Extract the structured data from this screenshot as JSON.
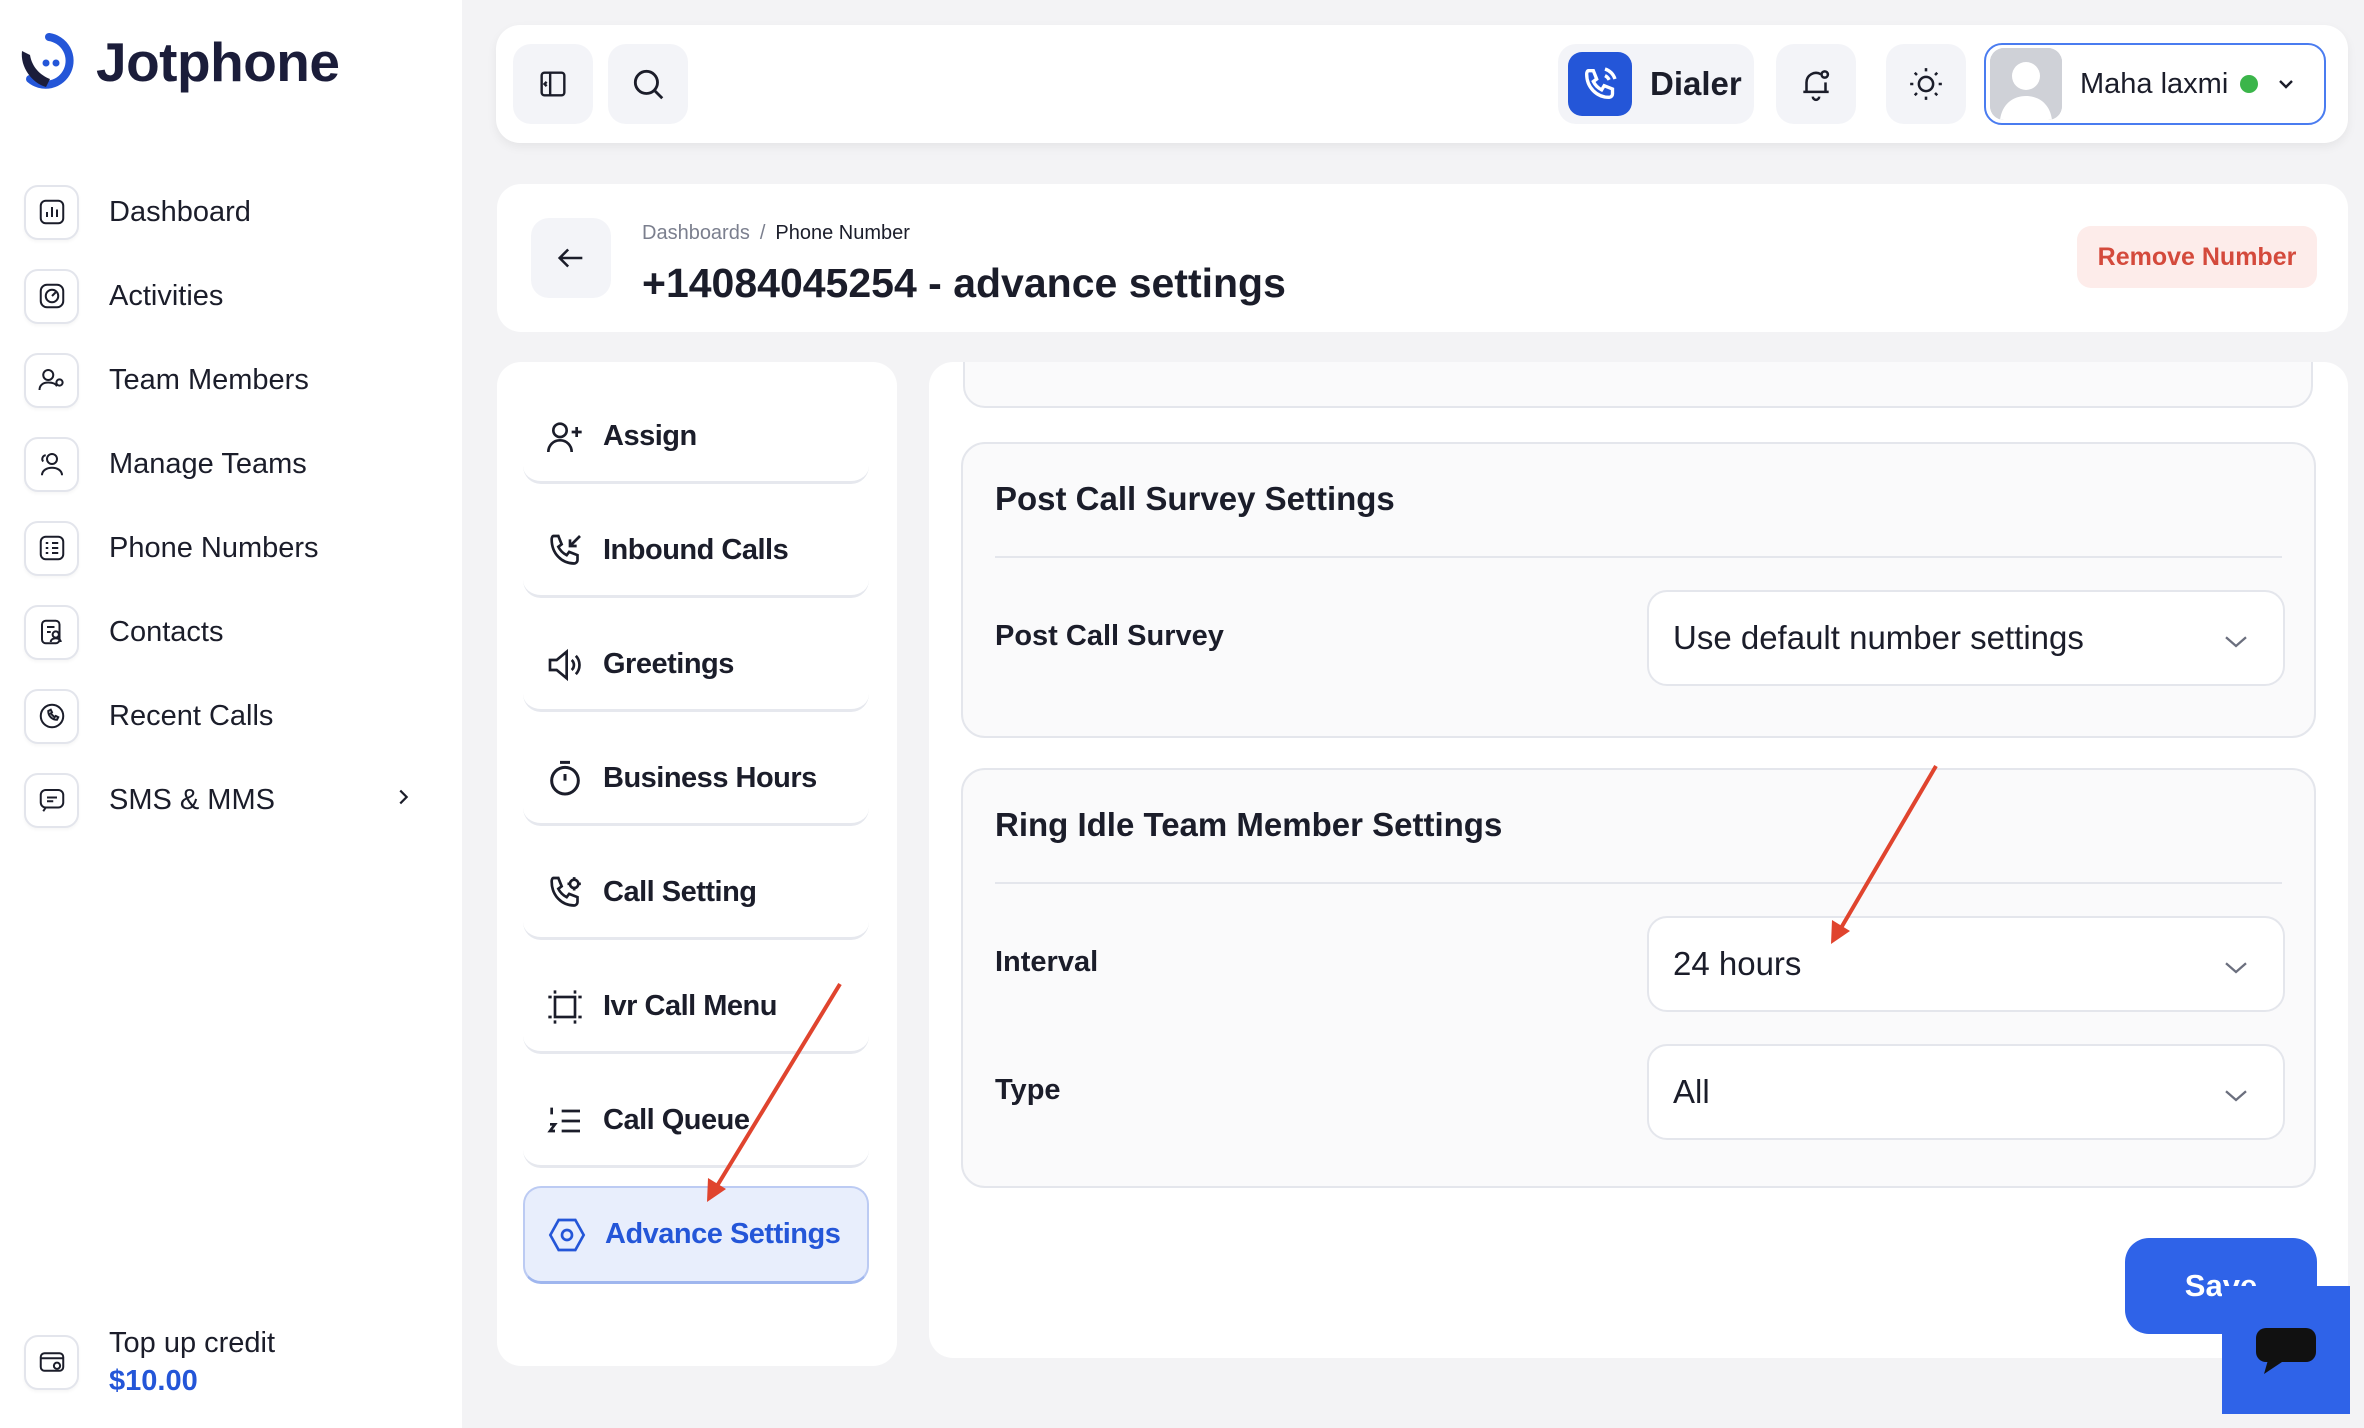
{
  "brand": {
    "name": "Jotphone",
    "accent": "#2456d8"
  },
  "sidebar": {
    "items": [
      {
        "label": "Dashboard",
        "icon": "bar-chart-icon"
      },
      {
        "label": "Activities",
        "icon": "gauge-icon"
      },
      {
        "label": "Team Members",
        "icon": "user-gear-icon"
      },
      {
        "label": "Manage Teams",
        "icon": "users-icon"
      },
      {
        "label": "Phone Numbers",
        "icon": "phone-list-icon"
      },
      {
        "label": "Contacts",
        "icon": "contact-book-icon"
      },
      {
        "label": "Recent Calls",
        "icon": "phone-history-icon"
      },
      {
        "label": "SMS & MMS",
        "icon": "message-icon",
        "has_submenu": true
      }
    ],
    "credit": {
      "label": "Top up credit",
      "amount": "$10.00"
    }
  },
  "topbar": {
    "dialer_label": "Dialer",
    "user": {
      "name": "Maha laxmi",
      "status_color": "#3bb54a"
    }
  },
  "header": {
    "breadcrumb": [
      "Dashboards",
      "/",
      "Phone Number"
    ],
    "title": "+14084045254 - advance settings",
    "remove_label": "Remove Number"
  },
  "subnav": {
    "items": [
      {
        "label": "Assign",
        "icon": "user-plus-icon"
      },
      {
        "label": "Inbound Calls",
        "icon": "incoming-call-icon"
      },
      {
        "label": "Greetings",
        "icon": "speaker-icon"
      },
      {
        "label": "Business Hours",
        "icon": "stopwatch-icon"
      },
      {
        "label": "Call Setting",
        "icon": "phone-settings-icon"
      },
      {
        "label": "Ivr Call Menu",
        "icon": "ivr-frame-icon"
      },
      {
        "label": "Call Queue",
        "icon": "numbered-list-icon"
      },
      {
        "label": "Advance Settings",
        "icon": "hexagon-settings-icon",
        "active": true
      }
    ]
  },
  "post_call_survey": {
    "title": "Post Call Survey Settings",
    "label": "Post Call Survey",
    "value": "Use default number settings"
  },
  "ring_idle": {
    "title": "Ring Idle Team Member Settings",
    "interval_label": "Interval",
    "interval_value": "24 hours",
    "type_label": "Type",
    "type_value": "All"
  },
  "save_label": "Save"
}
